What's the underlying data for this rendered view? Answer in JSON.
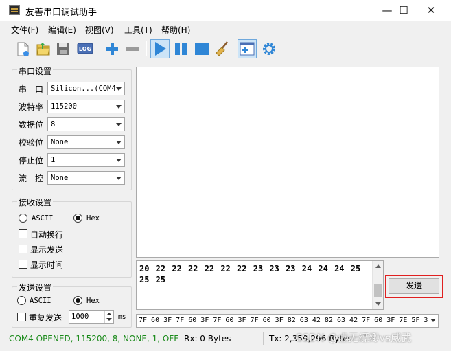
{
  "window": {
    "title": "友善串口调试助手",
    "controls": {
      "minimize": "—",
      "maximize": "☐",
      "close": "✕"
    }
  },
  "menu": [
    "文件(F)",
    "编辑(E)",
    "视图(V)",
    "工具(T)",
    "帮助(H)"
  ],
  "toolbar": {
    "log_label": "LOG",
    "buttons": [
      "new-icon",
      "open-icon",
      "save-icon",
      "log-icon",
      "add-icon",
      "remove-icon",
      "play-icon",
      "pause-icon",
      "stop-icon",
      "clear-icon",
      "window-icon",
      "settings-icon"
    ]
  },
  "serial_settings": {
    "title": "串口设置",
    "rows": [
      {
        "label": "串　口",
        "value": "Silicon...(COM4"
      },
      {
        "label": "波特率",
        "value": "115200"
      },
      {
        "label": "数据位",
        "value": "8"
      },
      {
        "label": "校验位",
        "value": "None"
      },
      {
        "label": "停止位",
        "value": "1"
      },
      {
        "label": "流　控",
        "value": "None"
      }
    ]
  },
  "receive_settings": {
    "title": "接收设置",
    "ascii_label": "ASCII",
    "hex_label": "Hex",
    "selected": "Hex",
    "auto_wrap": "自动换行",
    "show_send": "显示发送",
    "show_time": "显示时间"
  },
  "send_settings": {
    "title": "发送设置",
    "ascii_label": "ASCII",
    "hex_label": "Hex",
    "selected": "Hex",
    "repeat_label": "重复发送",
    "repeat_value": "1000",
    "unit": "ms"
  },
  "tx": {
    "text": "20 22 22 22 22 22 22 23 23 23 24 24 24 25 25 25"
  },
  "send_button": "发送",
  "history": "7F 60 3F 7F 60 3F 7F 60 3F 7F 60 3F 82 63 42 82 63 42 7F 60 3F 7E 5F 3",
  "status": {
    "port": "COM4 OPENED, 115200, 8, NONE, 1, OFF",
    "rx": "Rx: 0 Bytes",
    "tx": "Tx: 2,359,296 Bytes",
    "port_color": "#1a8a1a"
  },
  "watermark": "CSDN @虚无缥缈vs威武"
}
